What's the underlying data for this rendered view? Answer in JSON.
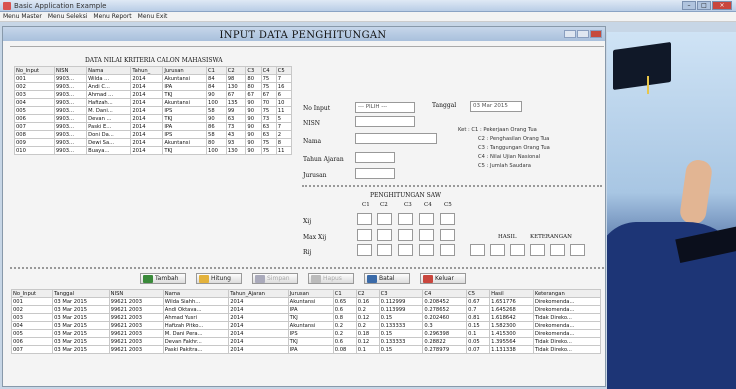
{
  "app": {
    "title": "Basic Application Example",
    "menus": [
      "Menu Master",
      "Menu Seleksi",
      "Menu Report",
      "Menu Exit"
    ]
  },
  "form": {
    "heading": "INPUT DATA PENGHITUNGAN",
    "criteria_caption": "DATA NILAI KRITERIA CALON MAHASISWA",
    "criteria_columns": [
      "No_Input",
      "NISN",
      "Nama",
      "Tahun_",
      "Jurusan",
      "C1",
      "C2",
      "C3",
      "C4",
      "C5"
    ],
    "criteria_rows": [
      [
        "001",
        "9903...",
        "Wilda ...",
        "2014",
        "Akuntansi",
        "84",
        "98",
        "80",
        "75",
        "7"
      ],
      [
        "002",
        "9903...",
        "Andi C...",
        "2014",
        "IPA",
        "84",
        "130",
        "80",
        "75",
        "16"
      ],
      [
        "003",
        "9903...",
        "Ahmad ...",
        "2014",
        "TKJ",
        "90",
        "67",
        "67",
        "67",
        "6"
      ],
      [
        "004",
        "9903...",
        "Hafizah...",
        "2014",
        "Akuntansi",
        "100",
        "135",
        "90",
        "70",
        "10"
      ],
      [
        "005",
        "9903...",
        "M. Dani...",
        "2014",
        "IPS",
        "58",
        "99",
        "90",
        "75",
        "11"
      ],
      [
        "006",
        "9903...",
        "Devan ...",
        "2014",
        "TKJ",
        "90",
        "63",
        "90",
        "73",
        "5"
      ],
      [
        "007",
        "9903...",
        "Paski E...",
        "2014",
        "IPA",
        "86",
        "73",
        "90",
        "63",
        "7"
      ],
      [
        "008",
        "9903...",
        "Doni Da...",
        "2014",
        "IPS",
        "58",
        "43",
        "90",
        "63",
        "2"
      ],
      [
        "009",
        "9903...",
        "Dewi Sa...",
        "2014",
        "Akuntansi",
        "80",
        "93",
        "90",
        "75",
        "8"
      ],
      [
        "010",
        "9903...",
        "Buaya...",
        "2014",
        "TKJ",
        "100",
        "130",
        "90",
        "75",
        "11"
      ]
    ],
    "fields": {
      "no_input_label": "No Input",
      "no_input_value": "--- PILIH ---",
      "tanggal_label": "Tanggal",
      "tanggal_value": "03 Mar 2015",
      "nisn_label": "NISN",
      "nama_label": "Nama",
      "tahun_label": "Tahun Ajaran",
      "jurusan_label": "Jurusan"
    },
    "notes": [
      "Ket : C1 : Pekerjaan Orang Tua",
      "C2 : Penghasilan Orang Tua",
      "C3 : Tanggungan Orang Tua",
      "C4 : Nilai Ujian Nasional",
      "C5 : Jumlah Saudara"
    ],
    "calc": {
      "title": "PENGHITUNGAN SAW",
      "cols": [
        "C1",
        "C2",
        "C3",
        "C4",
        "C5"
      ],
      "row_labels": [
        "Xij",
        "Max Xij",
        "Rij"
      ],
      "hasil_label": "HASIL",
      "ket_label": "KETERANGAN"
    },
    "buttons": {
      "tambah": "Tambah",
      "hitung": "Hitung",
      "simpan": "Simpan",
      "hapus": "Hapus",
      "batal": "Batal",
      "keluar": "Keluar"
    },
    "result_columns": [
      "No_Input",
      "Tanggal",
      "NISN",
      "Nama",
      "Tahun_Ajaran",
      "Jurusan",
      "C1",
      "C2",
      "C3",
      "C4",
      "C5",
      "Hasil",
      "Keterangan"
    ],
    "result_rows": [
      [
        "001",
        "03 Mar 2015",
        "99621 2003",
        "Wilda Siahh...",
        "2014",
        "Akuntansi",
        "0.65",
        "0.16",
        "0.112999",
        "0.208452",
        "0.67",
        "1.651776",
        "Direkomenda..."
      ],
      [
        "002",
        "03 Mar 2015",
        "99621 2003",
        "Andi Oktava...",
        "2014",
        "IPA",
        "0.6",
        "0.2",
        "0.113999",
        "0.278652",
        "0.7",
        "1.645268",
        "Direkomenda..."
      ],
      [
        "003",
        "03 Mar 2015",
        "99621 2003",
        "Ahmad Yusri",
        "2014",
        "TKJ",
        "0.8",
        "0.12",
        "0.15",
        "0.202460",
        "0.81",
        "1.618642",
        "Tidak Direko..."
      ],
      [
        "004",
        "03 Mar 2015",
        "99621 2003",
        "Hafizah Pitko...",
        "2014",
        "Akuntansi",
        "0.2",
        "0.2",
        "0.133333",
        "0.3",
        "0.15",
        "1.582300",
        "Direkomenda..."
      ],
      [
        "005",
        "03 Mar 2015",
        "99621 2003",
        "M. Dani Pera...",
        "2014",
        "IPS",
        "0.2",
        "0.18",
        "0.15",
        "0.296398",
        "0.1",
        "1.415300",
        "Direkomenda..."
      ],
      [
        "006",
        "03 Mar 2015",
        "99621 2003",
        "Devan Fakhr...",
        "2014",
        "TKJ",
        "0.6",
        "0.12",
        "0.133333",
        "0.28822",
        "0.05",
        "1.395564",
        "Tidak Direko..."
      ],
      [
        "007",
        "03 Mar 2015",
        "99621 2003",
        "Paski Pakitra...",
        "2014",
        "IPA",
        "0.08",
        "0.1",
        "0.15",
        "0.278979",
        "0.07",
        "1.131338",
        "Tidak Direko..."
      ]
    ]
  },
  "colors": {
    "accent": "#3a6aa8"
  }
}
